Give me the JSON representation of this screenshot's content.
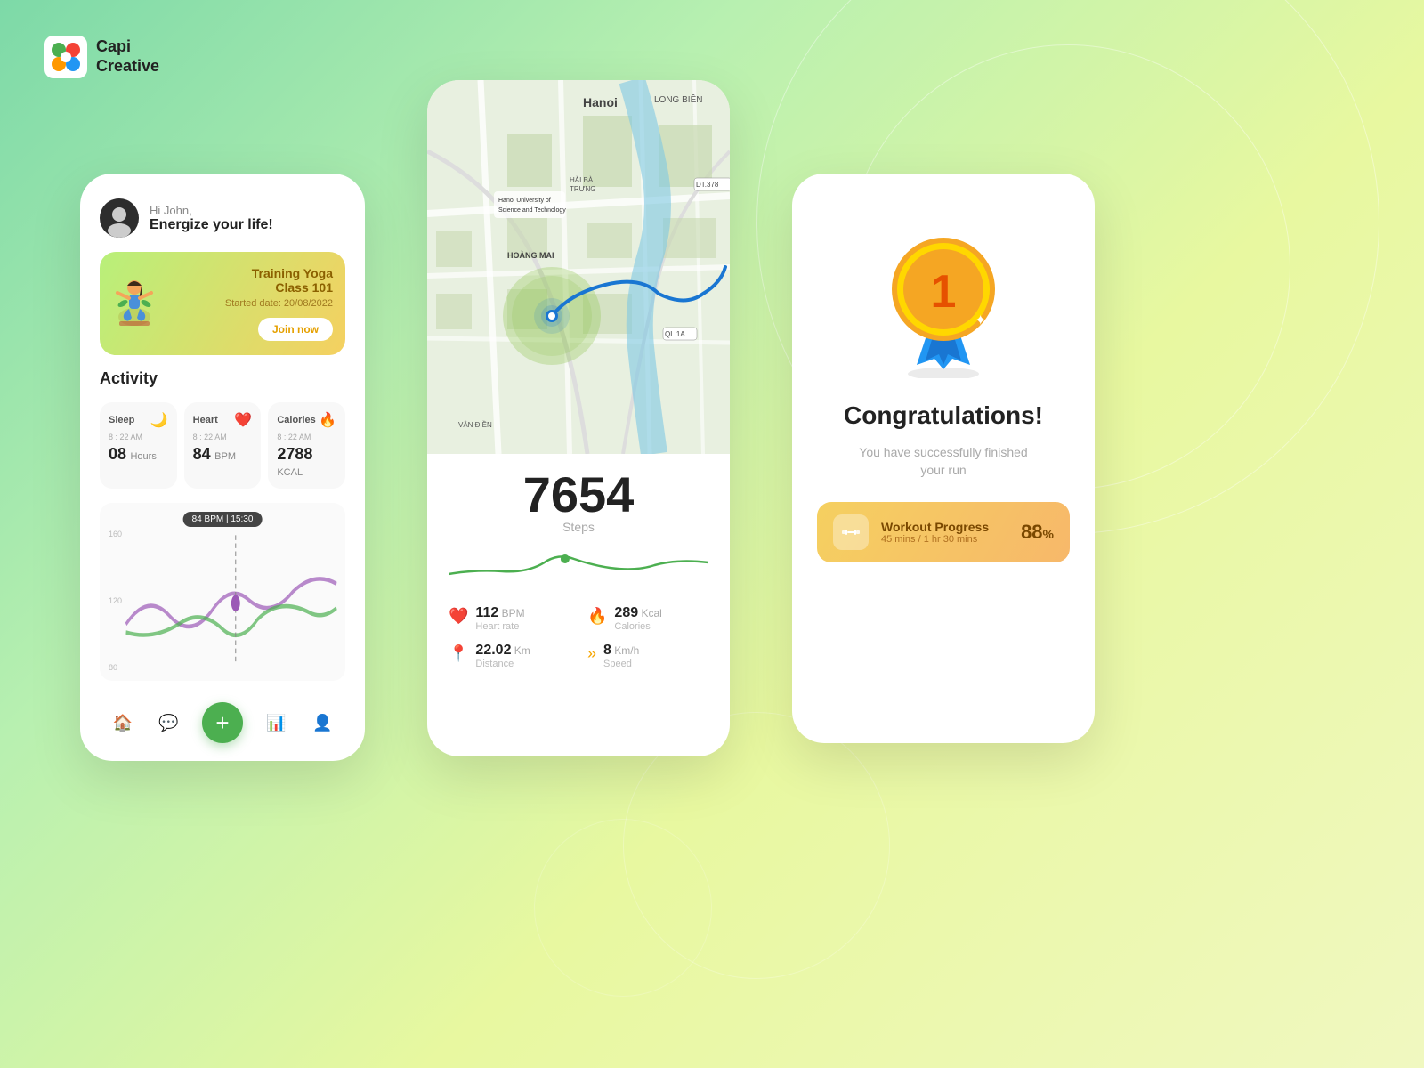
{
  "logo": {
    "name1": "Capi",
    "name2": "Creative"
  },
  "phone1": {
    "greeting_hi": "Hi John,",
    "greeting_energize": "Energize your life!",
    "training": {
      "title": "Training Yoga",
      "class": "Class 101",
      "started": "Started date: 20/08/2022",
      "join_btn": "Join now"
    },
    "activity": {
      "section_title": "Activity",
      "items": [
        {
          "label": "Sleep",
          "time": "8 : 22 AM",
          "value": "08",
          "unit": "Hours",
          "icon": "🌙"
        },
        {
          "label": "Heart",
          "time": "8 : 22 AM",
          "value": "84",
          "unit": "BPM",
          "icon": "❤️"
        },
        {
          "label": "Calories",
          "time": "8 : 22 AM",
          "value": "2788",
          "unit": "KCAL",
          "icon": "🔥"
        }
      ]
    },
    "chart": {
      "tooltip": "84 BPM | 15:30",
      "y_labels": [
        "160",
        "120",
        "80"
      ]
    }
  },
  "phone2": {
    "map_city": "Hanoi",
    "steps_number": "7654",
    "steps_label": "Steps",
    "stats": [
      {
        "icon": "❤️",
        "value": "112",
        "unit": "BPM",
        "name": "Heart rate"
      },
      {
        "icon": "🔥",
        "value": "289",
        "unit": "Kcal",
        "name": "Calories"
      },
      {
        "icon": "📍",
        "value": "22.02",
        "unit": "Km",
        "name": "Distance"
      },
      {
        "icon": "»",
        "value": "8",
        "unit": "Km/h",
        "name": "Speed"
      }
    ]
  },
  "phone3": {
    "congrats_title": "Congratulations!",
    "congrats_subtitle": "You have successfully finished\nyour run",
    "workout": {
      "label": "Workout Progress",
      "time1": "45 mins",
      "time2": "1 hr 30 mins",
      "percent": "88",
      "percent_sign": "%"
    }
  }
}
